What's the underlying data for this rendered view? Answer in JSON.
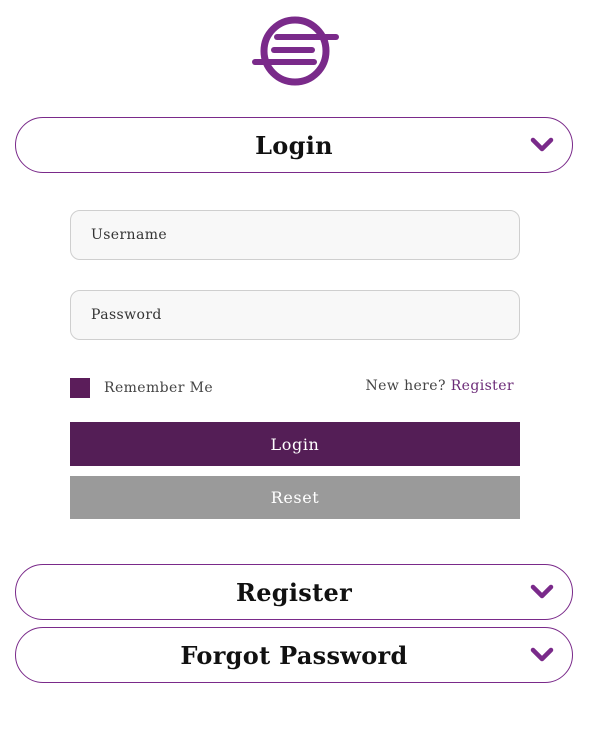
{
  "brand": {
    "accent_color": "#7a2a8a",
    "logo_icon": "circle-stripes-logo-icon"
  },
  "sections": {
    "login": {
      "title": "Login",
      "expanded": true,
      "chevron_icon": "chevron-down-icon"
    },
    "register": {
      "title": "Register",
      "expanded": false,
      "chevron_icon": "chevron-down-icon"
    },
    "forgot": {
      "title": "Forgot Password",
      "expanded": false,
      "chevron_icon": "chevron-down-icon"
    }
  },
  "login_form": {
    "username_placeholder": "Username",
    "username_value": "",
    "password_placeholder": "Password",
    "password_value": "",
    "remember_label": "Remember Me",
    "remember_checked": true,
    "new_here_text": "New here?",
    "register_link": "Register",
    "login_button": "Login",
    "reset_button": "Reset",
    "login_button_color": "#541e56",
    "reset_button_color": "#9a9a9a"
  }
}
